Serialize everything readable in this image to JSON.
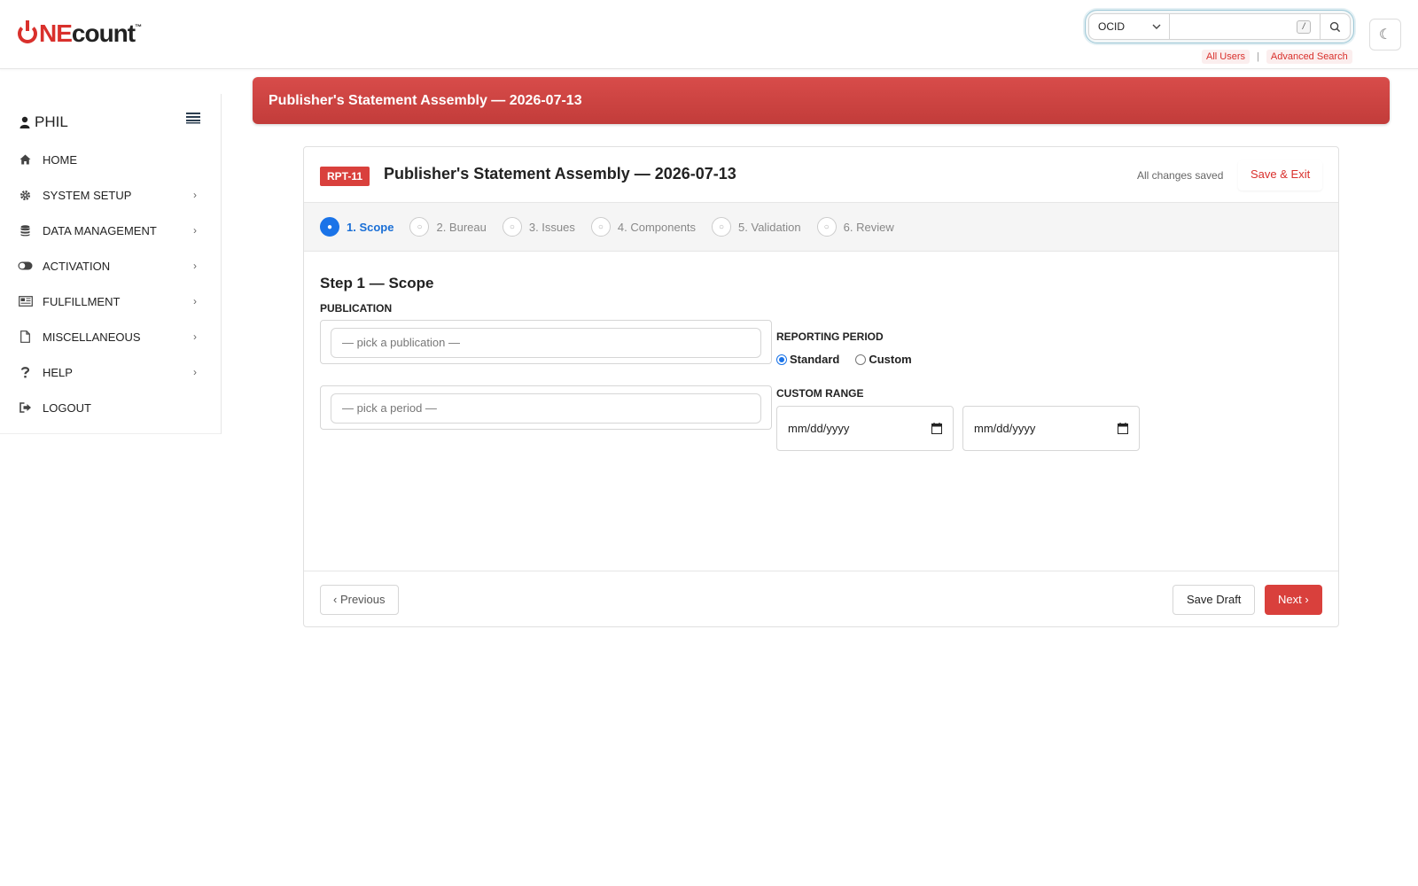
{
  "header": {
    "logo": {
      "prefix": "",
      "ne": "NE",
      "count": "count",
      "tm": "™"
    },
    "search": {
      "type_selected": "OCID",
      "input_value": "",
      "shortcut_hint": "/",
      "links": {
        "all_users": "All Users",
        "separator": "|",
        "advanced_search": "Advanced Search"
      }
    },
    "theme_toggle_icon": "☾"
  },
  "sidebar": {
    "user_name": "PHIL",
    "items": [
      {
        "label": "HOME",
        "icon": "home-icon",
        "has_submenu": false
      },
      {
        "label": "SYSTEM SETUP",
        "icon": "gear-icon",
        "has_submenu": true
      },
      {
        "label": "DATA MANAGEMENT",
        "icon": "database-icon",
        "has_submenu": true
      },
      {
        "label": "ACTIVATION",
        "icon": "toggle-icon",
        "has_submenu": true
      },
      {
        "label": "FULFILLMENT",
        "icon": "newspaper-icon",
        "has_submenu": true
      },
      {
        "label": "MISCELLANEOUS",
        "icon": "file-icon",
        "has_submenu": true
      },
      {
        "label": "HELP",
        "icon": "question-icon",
        "has_submenu": true
      },
      {
        "label": "LOGOUT",
        "icon": "logout-icon",
        "has_submenu": false
      }
    ],
    "submenu_arrow": "›"
  },
  "banner": {
    "title": "Publisher's Statement Assembly — 2026-07-13"
  },
  "wizard": {
    "badge": "RPT-11",
    "title": "Publisher's Statement Assembly — 2026-07-13",
    "save_status": "All changes saved",
    "save_exit_label": "Save & Exit",
    "steps": [
      {
        "label": "1. Scope",
        "active": true,
        "dot": "●"
      },
      {
        "label": "2. Bureau",
        "active": false,
        "dot": "○"
      },
      {
        "label": "3. Issues",
        "active": false,
        "dot": "○"
      },
      {
        "label": "4. Components",
        "active": false,
        "dot": "○"
      },
      {
        "label": "5. Validation",
        "active": false,
        "dot": "○"
      },
      {
        "label": "6. Review",
        "active": false,
        "dot": "○"
      }
    ],
    "step_title": "Step 1 — Scope",
    "publication": {
      "label": "PUBLICATION",
      "placeholder": "— pick a publication —"
    },
    "period": {
      "placeholder": "— pick a period —"
    },
    "reporting_period": {
      "label": "REPORTING PERIOD",
      "options": [
        {
          "label": "Standard",
          "checked": true
        },
        {
          "label": "Custom",
          "checked": false
        }
      ]
    },
    "custom_range": {
      "label": "CUSTOM RANGE",
      "start_placeholder": "mm/dd/yyyy",
      "end_placeholder": "mm/dd/yyyy"
    },
    "footer": {
      "previous_label": "‹ Previous",
      "save_draft_label": "Save Draft",
      "next_label": "Next ›"
    }
  },
  "colors": {
    "brand_red": "#d9302c",
    "active_blue": "#1a73e8"
  }
}
